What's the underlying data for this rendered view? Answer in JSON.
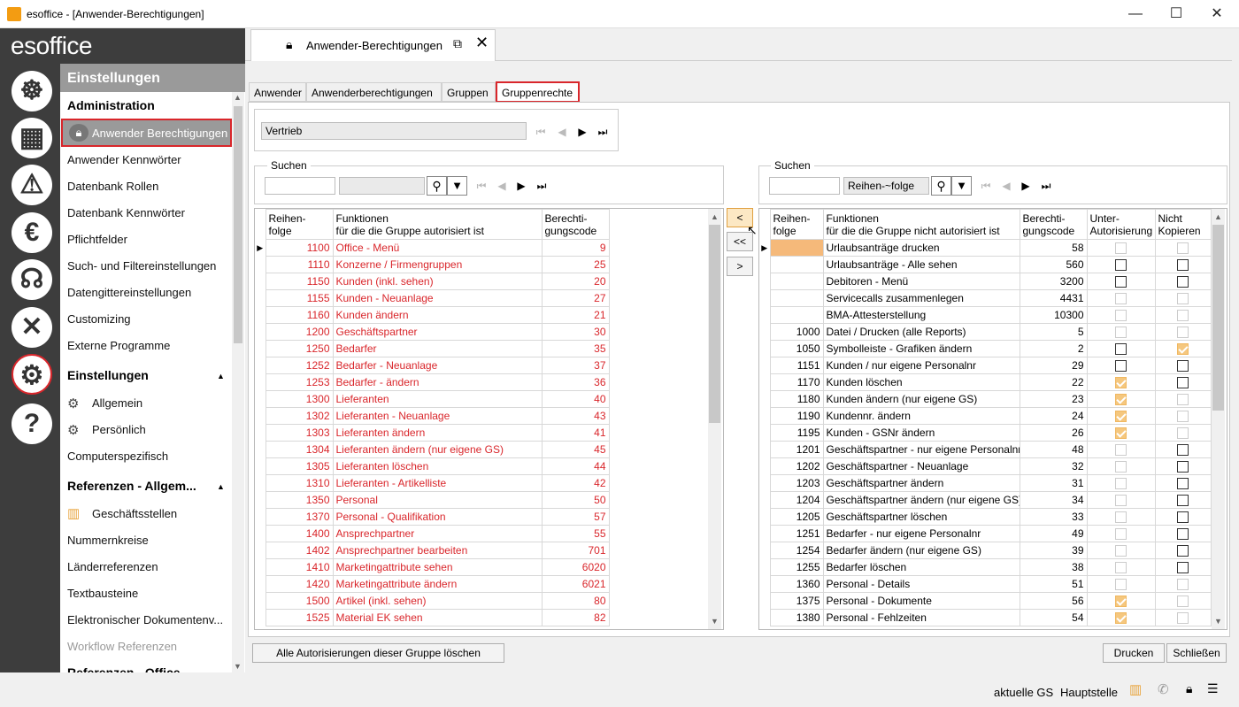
{
  "window": {
    "title": "esoffice - [Anwender-Berechtigungen]",
    "minimize": "—",
    "maximize": "☐",
    "close": "✕"
  },
  "logo": "esoffice",
  "rail_icons": [
    "ship-wheel-icon",
    "building-icon",
    "alarm-light-icon",
    "euro-icon",
    "headset-icon",
    "tools-icon",
    "settings-gears-icon",
    "help-icon"
  ],
  "nav": {
    "header": "Einstellungen",
    "sections": [
      {
        "title": "Administration",
        "items": [
          "Anwender Berechtigungen",
          "Anwender Kennwörter",
          "Datenbank Rollen",
          "Datenbank Kennwörter",
          "Pflichtfelder",
          "Such- und Filtereinstellungen",
          "Datengittereinstellungen",
          "Customizing",
          "Externe Programme"
        ]
      },
      {
        "title": "Einstellungen",
        "items": [
          "Allgemein",
          "Persönlich",
          "Computerspezifisch"
        ]
      },
      {
        "title": "Referenzen - Allgem...",
        "items": [
          "Geschäftsstellen",
          "Nummernkreise",
          "Länderreferenzen",
          "Textbausteine",
          "Elektronischer Dokumentenv...",
          "Workflow Referenzen"
        ]
      },
      {
        "title": "Referenzen - Office",
        "items": []
      }
    ]
  },
  "doc_tab": {
    "label": "Anwender-Berechtigungen"
  },
  "tabs": [
    "Anwender",
    "Anwenderberechtigungen",
    "Gruppen",
    "Gruppenrechte"
  ],
  "group_field": "Vertrieb",
  "left": {
    "search_label": "Suchen",
    "search_value": "",
    "search_value2": "",
    "headers": [
      "Reihen-\nfolge",
      "Funktionen\nfür die die Gruppe autorisiert ist",
      "Berechti-\ngungscode"
    ],
    "rows": [
      [
        "1100",
        "Office - Menü",
        "9"
      ],
      [
        "1110",
        "Konzerne / Firmengruppen",
        "25"
      ],
      [
        "1150",
        "Kunden (inkl. sehen)",
        "20"
      ],
      [
        "1155",
        "Kunden - Neuanlage",
        "27"
      ],
      [
        "1160",
        "Kunden ändern",
        "21"
      ],
      [
        "1200",
        "Geschäftspartner",
        "30"
      ],
      [
        "1250",
        "Bedarfer",
        "35"
      ],
      [
        "1252",
        "Bedarfer - Neuanlage",
        "37"
      ],
      [
        "1253",
        "Bedarfer - ändern",
        "36"
      ],
      [
        "1300",
        "Lieferanten",
        "40"
      ],
      [
        "1302",
        "Lieferanten - Neuanlage",
        "43"
      ],
      [
        "1303",
        "Lieferanten ändern",
        "41"
      ],
      [
        "1304",
        "Lieferanten ändern (nur eigene GS)",
        "45"
      ],
      [
        "1305",
        "Lieferanten löschen",
        "44"
      ],
      [
        "1310",
        "Lieferanten - Artikelliste",
        "42"
      ],
      [
        "1350",
        "Personal",
        "50"
      ],
      [
        "1370",
        "Personal - Qualifikation",
        "57"
      ],
      [
        "1400",
        "Ansprechpartner",
        "55"
      ],
      [
        "1402",
        "Ansprechpartner bearbeiten",
        "701"
      ],
      [
        "1410",
        "Marketingattribute sehen",
        "6020"
      ],
      [
        "1420",
        "Marketingattribute ändern",
        "6021"
      ],
      [
        "1500",
        "Artikel (inkl. sehen)",
        "80"
      ],
      [
        "1525",
        "Material EK sehen",
        "82"
      ]
    ]
  },
  "mid_buttons": [
    "<",
    "<<",
    ">"
  ],
  "right": {
    "search_label": "Suchen",
    "search_value": "",
    "sort_field": "Reihen-~folge",
    "headers": [
      "Reihen-\nfolge",
      "Funktionen\nfür die die Gruppe nicht autorisiert ist",
      "Berechti-\ngungscode",
      "Unter-\nAutorisierung",
      "Nicht\nKopieren"
    ],
    "rows": [
      {
        "seq": "",
        "name": "Urlaubsanträge drucken",
        "code": "58",
        "ua": "dis",
        "nk": "dis"
      },
      {
        "seq": "",
        "name": "Urlaubsanträge - Alle sehen",
        "code": "560",
        "ua": "on",
        "nk": "on"
      },
      {
        "seq": "",
        "name": "Debitoren - Menü",
        "code": "3200",
        "ua": "on",
        "nk": "on"
      },
      {
        "seq": "",
        "name": "Servicecalls zusammenlegen",
        "code": "4431",
        "ua": "dis",
        "nk": "dis"
      },
      {
        "seq": "",
        "name": "BMA-Attesterstellung",
        "code": "10300",
        "ua": "dis",
        "nk": "dis"
      },
      {
        "seq": "1000",
        "name": "Datei / Drucken (alle Reports)",
        "code": "5",
        "ua": "dis",
        "nk": "dis"
      },
      {
        "seq": "1050",
        "name": "Symbolleiste - Grafiken ändern",
        "code": "2",
        "ua": "on",
        "nk": "chk"
      },
      {
        "seq": "1151",
        "name": "Kunden / nur eigene Personalnr",
        "code": "29",
        "ua": "on",
        "nk": "on"
      },
      {
        "seq": "1170",
        "name": "Kunden löschen",
        "code": "22",
        "ua": "chk",
        "nk": "on"
      },
      {
        "seq": "1180",
        "name": "Kunden ändern (nur eigene GS)",
        "code": "23",
        "ua": "chk",
        "nk": "dis"
      },
      {
        "seq": "1190",
        "name": "Kundennr. ändern",
        "code": "24",
        "ua": "chk",
        "nk": "dis"
      },
      {
        "seq": "1195",
        "name": "Kunden - GSNr ändern",
        "code": "26",
        "ua": "chk",
        "nk": "dis"
      },
      {
        "seq": "1201",
        "name": "Geschäftspartner - nur eigene Personalnr",
        "code": "48",
        "ua": "dis",
        "nk": "on"
      },
      {
        "seq": "1202",
        "name": "Geschäftspartner - Neuanlage",
        "code": "32",
        "ua": "dis",
        "nk": "on"
      },
      {
        "seq": "1203",
        "name": "Geschäftspartner ändern",
        "code": "31",
        "ua": "dis",
        "nk": "on"
      },
      {
        "seq": "1204",
        "name": "Geschäftspartner ändern (nur eigene GS)",
        "code": "34",
        "ua": "dis",
        "nk": "on"
      },
      {
        "seq": "1205",
        "name": "Geschäftspartner löschen",
        "code": "33",
        "ua": "dis",
        "nk": "on"
      },
      {
        "seq": "1251",
        "name": "Bedarfer - nur eigene Personalnr",
        "code": "49",
        "ua": "dis",
        "nk": "on"
      },
      {
        "seq": "1254",
        "name": "Bedarfer ändern (nur eigene GS)",
        "code": "39",
        "ua": "dis",
        "nk": "on"
      },
      {
        "seq": "1255",
        "name": "Bedarfer löschen",
        "code": "38",
        "ua": "dis",
        "nk": "on"
      },
      {
        "seq": "1360",
        "name": "Personal - Details",
        "code": "51",
        "ua": "dis",
        "nk": "dis"
      },
      {
        "seq": "1375",
        "name": "Personal - Dokumente",
        "code": "56",
        "ua": "chk",
        "nk": "dis"
      },
      {
        "seq": "1380",
        "name": "Personal - Fehlzeiten",
        "code": "54",
        "ua": "chk",
        "nk": "dis"
      }
    ]
  },
  "buttons": {
    "delete_all": "Alle Autorisierungen dieser Gruppe löschen",
    "print": "Drucken",
    "close": "Schließen"
  },
  "status": {
    "branch_label": "aktuelle GS",
    "branch_value": "Hauptstelle"
  }
}
